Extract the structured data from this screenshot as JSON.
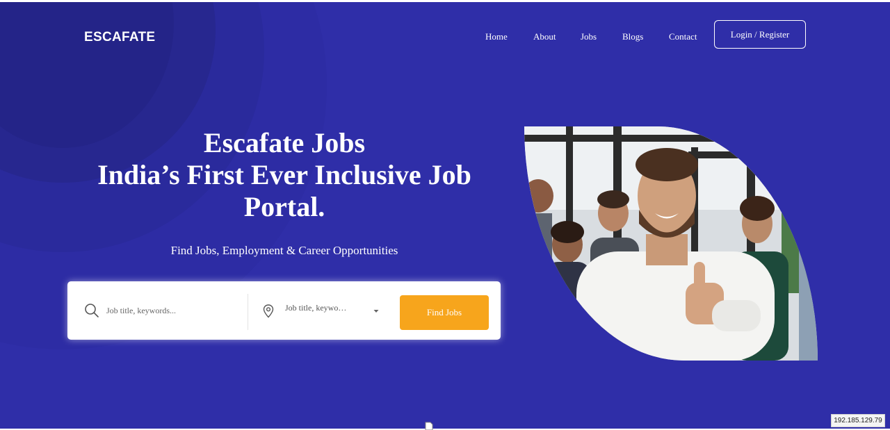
{
  "brand": {
    "logo_text": "ESCAFATE"
  },
  "nav": {
    "items": [
      {
        "label": "Home"
      },
      {
        "label": "About"
      },
      {
        "label": "Jobs"
      },
      {
        "label": "Blogs"
      },
      {
        "label": "Contact"
      }
    ],
    "login_label": "Login / Register"
  },
  "hero": {
    "headline_line1": "Escafate Jobs",
    "headline_line2": "India’s First Ever Inclusive Job",
    "headline_line3": "Portal.",
    "subtitle": "Find Jobs, Employment & Career Opportunities"
  },
  "search": {
    "keyword_placeholder": "Job title, keywords...",
    "location_value": "Job title, keywo…",
    "button_label": "Find Jobs",
    "icons": [
      "search-icon",
      "map-pin-icon",
      "chevron-down-icon"
    ]
  },
  "status": {
    "ip_address": "192.185.129.79"
  },
  "colors": {
    "hero_background": "#2f2ea8",
    "button_accent": "#f7a51c",
    "text_on_hero": "#ffffff"
  }
}
